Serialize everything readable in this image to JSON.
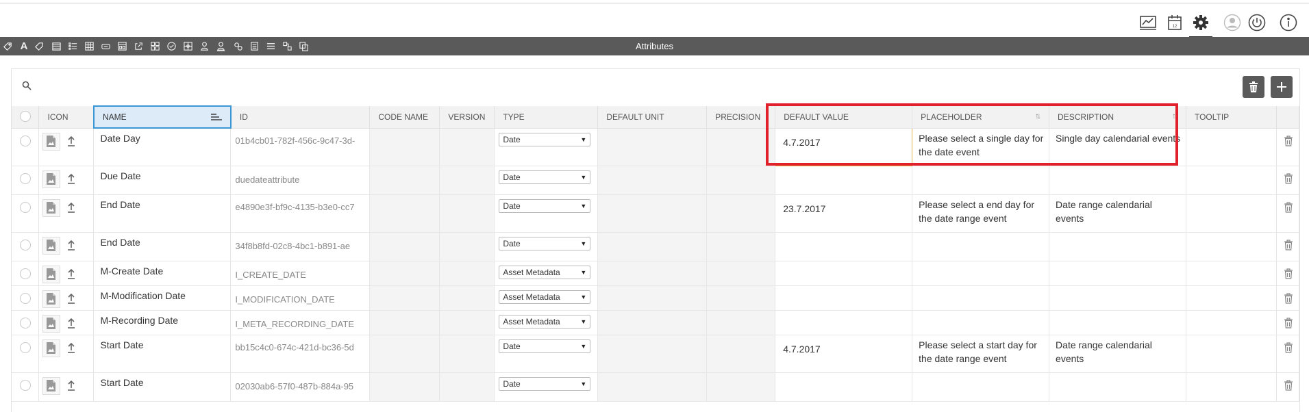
{
  "header": {
    "icons": [
      "chart-icon",
      "calendar-icon",
      "gear-icon",
      "user-icon",
      "power-icon",
      "info-icon"
    ],
    "active_icon": "gear-icon"
  },
  "toolbar": {
    "title": "Attributes",
    "icons": [
      "tag-icon",
      "text-icon",
      "tag-outline-icon",
      "calendar-grid-icon",
      "checklist-icon",
      "table-icon",
      "textbox-icon",
      "form-icon",
      "link-icon",
      "grid-icon",
      "checkmark-icon",
      "network-icon",
      "person-icon",
      "person-tree-icon",
      "gears-icon",
      "stack-icon",
      "lines-icon",
      "hierarchy-icon",
      "copy-icon"
    ]
  },
  "search": {
    "placeholder": ""
  },
  "actions": {
    "delete": "trash-icon",
    "add": "plus-icon"
  },
  "table": {
    "columns": {
      "icon": "ICON",
      "name": "NAME",
      "id": "ID",
      "code_name": "CODE NAME",
      "version": "VERSION",
      "type": "TYPE",
      "default_unit": "DEFAULT UNIT",
      "precision": "PRECISION",
      "default_value": "DEFAULT VALUE",
      "placeholder": "PLACEHOLDER",
      "description": "DESCRIPTION",
      "tooltip": "TOOLTIP"
    },
    "rows": [
      {
        "name": "Date Day",
        "id": "01b4cb01-782f-456c-9c47-3d-",
        "type": "Date",
        "default_value": "4.7.2017",
        "placeholder": "Please select a single day for the date event",
        "description": "Single day calendarial events"
      },
      {
        "name": "Due Date",
        "id": "duedateattribute",
        "type": "Date",
        "default_value": "",
        "placeholder": "",
        "description": ""
      },
      {
        "name": "End Date",
        "id": "e4890e3f-bf9c-4135-b3e0-cc7",
        "type": "Date",
        "default_value": "23.7.2017",
        "placeholder": "Please select a end day for the date range event",
        "description": "Date range calendarial events"
      },
      {
        "name": "End Date",
        "id": "34f8b8fd-02c8-4bc1-b891-ae",
        "type": "Date",
        "default_value": "",
        "placeholder": "",
        "description": ""
      },
      {
        "name": "M-Create Date",
        "id": "I_CREATE_DATE",
        "type": "Asset Metadata",
        "default_value": "",
        "placeholder": "",
        "description": ""
      },
      {
        "name": "M-Modification Date",
        "id": "I_MODIFICATION_DATE",
        "type": "Asset Metadata",
        "default_value": "",
        "placeholder": "",
        "description": ""
      },
      {
        "name": "M-Recording Date",
        "id": "I_META_RECORDING_DATE",
        "type": "Asset Metadata",
        "default_value": "",
        "placeholder": "",
        "description": ""
      },
      {
        "name": "Start Date",
        "id": "bb15c4c0-674c-421d-bc36-5d",
        "type": "Date",
        "default_value": "4.7.2017",
        "placeholder": "Please select a start day for the date range event",
        "description": "Date range calendarial events"
      },
      {
        "name": "Start Date",
        "id": "02030ab6-57f0-487b-884a-95",
        "type": "Date",
        "default_value": "",
        "placeholder": "",
        "description": ""
      }
    ]
  }
}
